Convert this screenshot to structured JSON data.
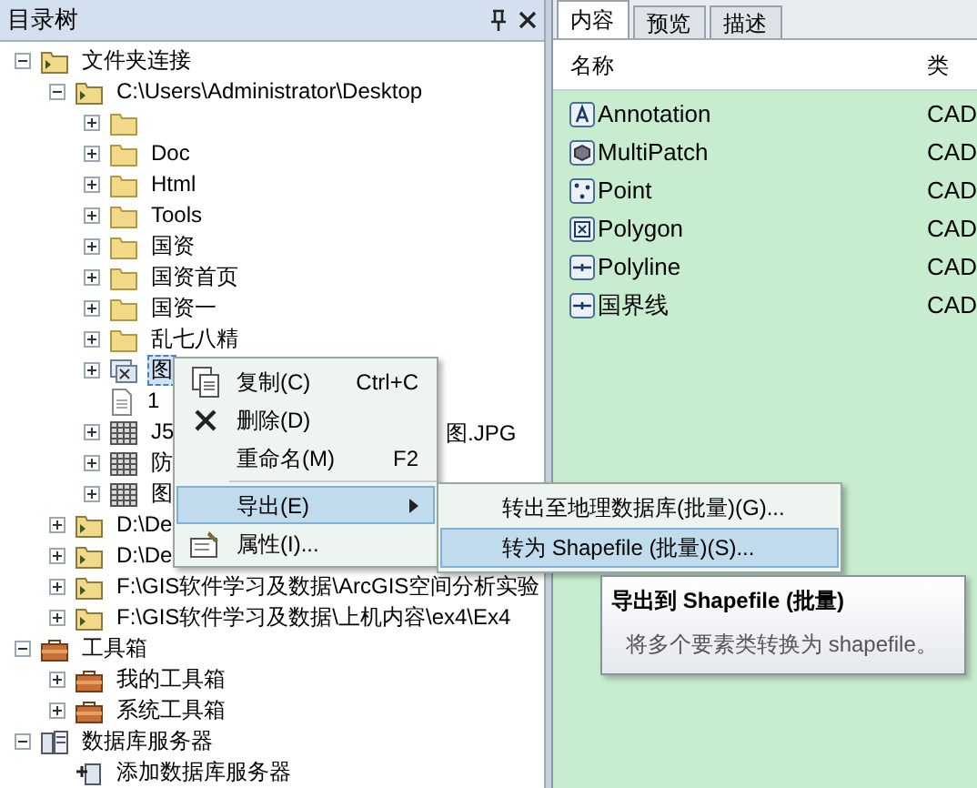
{
  "catalog": {
    "title": "目录树",
    "tree": [
      {
        "label": "文件夹连接",
        "kind": "connection",
        "expanded": true,
        "selected": false,
        "children": [
          {
            "label": "C:\\Users\\Administrator\\Desktop",
            "kind": "connection",
            "expanded": true,
            "selected": false,
            "children": [
              {
                "kind": "folder",
                "expanded": false,
                "selected": false
              },
              {
                "label": "Doc",
                "kind": "folder",
                "expanded": false,
                "selected": false
              },
              {
                "label": "Html",
                "kind": "folder",
                "expanded": false,
                "selected": false
              },
              {
                "label": "Tools",
                "kind": "folder",
                "expanded": false,
                "selected": false
              },
              {
                "label": "国资",
                "kind": "folder",
                "expanded": false,
                "selected": false
              },
              {
                "label": "国资首页",
                "kind": "folder",
                "expanded": false,
                "selected": false
              },
              {
                "label": "国资一",
                "kind": "folder",
                "expanded": false,
                "selected": false
              },
              {
                "label": "乱七八精",
                "kind": "folder",
                "expanded": false,
                "selected": false
              },
              {
                "label": "图",
                "kind": "cad",
                "expanded": false,
                "selected": true
              },
              {
                "label": "1",
                "kind": "file",
                "selected": false
              },
              {
                "label": "J5",
                "tail": "图.JPG",
                "kind": "raster",
                "expanded": false,
                "selected": false
              },
              {
                "label": "防",
                "kind": "raster",
                "expanded": false,
                "selected": false
              },
              {
                "label": "图",
                "kind": "raster",
                "expanded": false,
                "selected": false
              }
            ]
          },
          {
            "label": "D:\\De",
            "kind": "connection",
            "expanded": false,
            "selected": false
          },
          {
            "label": "D:\\De",
            "kind": "connection",
            "expanded": false,
            "selected": false
          },
          {
            "label": "F:\\GIS软件学习及数据\\ArcGIS空间分析实验",
            "kind": "connection",
            "expanded": false,
            "selected": false
          },
          {
            "label": "F:\\GIS软件学习及数据\\上机内容\\ex4\\Ex4",
            "kind": "connection",
            "expanded": false,
            "selected": false
          }
        ]
      },
      {
        "label": "工具箱",
        "kind": "toolbox",
        "expanded": true,
        "selected": false,
        "children": [
          {
            "label": "我的工具箱",
            "kind": "toolbox",
            "expanded": false,
            "selected": false
          },
          {
            "label": "系统工具箱",
            "kind": "toolbox",
            "expanded": false,
            "selected": false
          }
        ]
      },
      {
        "label": "数据库服务器",
        "kind": "server",
        "expanded": true,
        "selected": false,
        "children": [
          {
            "label": "添加数据库服务器",
            "kind": "add",
            "selected": false
          }
        ]
      }
    ]
  },
  "context_menu": {
    "items": [
      {
        "label": "复制(C)",
        "shortcut": "Ctrl+C",
        "kind": "copy",
        "selected": false
      },
      {
        "label": "删除(D)",
        "kind": "delete",
        "selected": false
      },
      {
        "label": "重命名(M)",
        "shortcut": "F2",
        "kind": "plain",
        "selected": false
      },
      {
        "label": "导出(E)",
        "kind": "submenu",
        "selected": true
      },
      {
        "label": "属性(I)...",
        "kind": "properties",
        "selected": false
      }
    ]
  },
  "submenu": {
    "items": [
      {
        "label": "转出至地理数据库(批量)(G)...",
        "selected": false
      },
      {
        "label": "转为 Shapefile (批量)(S)...",
        "selected": true
      }
    ]
  },
  "tooltip": {
    "title": "导出到 Shapefile (批量)",
    "text": "将多个要素类转换为 shapefile。"
  },
  "contents": {
    "tabs": [
      {
        "label": "内容",
        "selected": true
      },
      {
        "label": "预览",
        "selected": false
      },
      {
        "label": "描述",
        "selected": false
      }
    ],
    "columns": [
      "名称",
      "类"
    ],
    "rows": [
      {
        "name": "Annotation",
        "type": "CAD",
        "kind": "annotation"
      },
      {
        "name": "MultiPatch",
        "type": "CAD",
        "kind": "multipatch"
      },
      {
        "name": "Point",
        "type": "CAD",
        "kind": "point"
      },
      {
        "name": "Polygon",
        "type": "CAD",
        "kind": "polygon"
      },
      {
        "name": "Polyline",
        "type": "CAD",
        "kind": "polyline"
      },
      {
        "name": "国界线",
        "type": "CAD",
        "kind": "polyline"
      }
    ]
  }
}
